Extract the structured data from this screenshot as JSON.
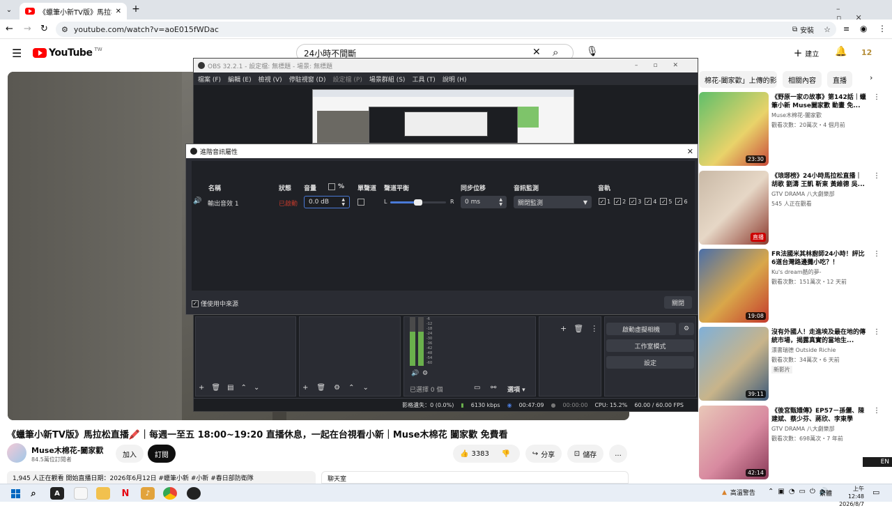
{
  "browser": {
    "tab_title": "《蠟筆小新TV版》馬拉松直",
    "url": "youtube.com/watch?v=aoE015fWDac",
    "install_label": "安裝"
  },
  "youtube": {
    "logo_text": "YouTube",
    "region": "TW",
    "search_value": "24小時不間斷",
    "create_label": "建立",
    "notif_count": "12",
    "video_title": "《蠟筆小新TV版》馬拉松直播🖍️｜每週一至五 18:00~19:20 直播休息，一起在台視看小新｜Muse木棉花 闔家歡 免費看",
    "channel_name": "Muse木棉花-闔家歡",
    "subscribers": "84.5萬位訂閱者",
    "join_label": "加入",
    "subscribe_label": "訂閱",
    "likes": "3383",
    "share_label": "分享",
    "save_label": "儲存",
    "more_label": "...",
    "watching_line": "1,945 人正在觀看  開始直播日期：2026年6月12日  #蠟筆小新 #小新 #春日部防衛隊",
    "chat_label": "聊天室",
    "chips": [
      "棉花-闔家歡」上傳的影片",
      "相關內容",
      "直播"
    ],
    "recommendations": [
      {
        "title": "《野原一家の故事》第142話｜蠟筆小新 Muse闔家歡 動畫 免...",
        "channel": "Muse木棉花-闔家歡",
        "meta": "觀看次數：20萬次・4 個月前",
        "duration": "23:30"
      },
      {
        "title": "《琅琊榜》24小時馬拉松直播｜胡歌 劉濤 王凱 靳東 黃維德 吳...",
        "channel": "GTV DRAMA 八大劇樂部",
        "meta": "545 人正在觀看",
        "duration": "直播"
      },
      {
        "title": "FR法國米其林廚師24小時！評比6道台灣路邊攤小吃？！",
        "channel": "Ku's dream酷的夢-",
        "meta": "觀看次數：151萬次・12 天前",
        "duration": "19:08"
      },
      {
        "title": "沒有外國人！走進埃及最在地的傳統市場，揭露真實的當地生...",
        "channel": "漂書瑞德 Outside Richie",
        "meta": "觀看次數：34萬次・6 天前",
        "extra": "新影片",
        "duration": "39:11"
      },
      {
        "title": "《後宮甄嬛傳》EP57－孫儷、陳建斌、蔡少芬、蔣欣、李東學",
        "channel": "GTV DRAMA 八大劇樂部",
        "meta": "觀看次數：698萬次・7 年前",
        "duration": "42:14"
      }
    ]
  },
  "obs": {
    "title": "OBS 32.2.1 - 設定檔: 無標題 - 場景: 無標題",
    "menu": [
      "檔案 (F)",
      "編輯 (E)",
      "檢視 (V)",
      "停駐視窗 (D)",
      "設定檔 (P)",
      "場景群組 (S)",
      "工具 (T)",
      "說明 (H)"
    ],
    "dialog_title": "進階音訊屬性",
    "headers": {
      "name": "名稱",
      "status": "狀態",
      "volume": "音量",
      "percent": "%",
      "mono": "單聲道",
      "balance": "聲道平衡",
      "sync": "同步位移",
      "monitor": "音訊監測",
      "tracks": "音軌"
    },
    "row": {
      "name": "輸出音效 1",
      "status": "已啟動",
      "volume": "0.0 dB",
      "balance_l": "L",
      "balance_r": "R",
      "sync": "0 ms",
      "monitor": "關閉監測"
    },
    "tracks": [
      "1",
      "2",
      "3",
      "4",
      "5",
      "6"
    ],
    "active_only_label": "僅使用中來源",
    "close_label": "關閉",
    "virtual_cam_label": "啟動虛擬相機",
    "studio_mode_label": "工作室模式",
    "settings_label": "設定",
    "selected_label": "已選擇 0 個",
    "options_label": "選項",
    "meter_ticks": [
      "-6",
      "-12",
      "-18",
      "-24",
      "-30",
      "-36",
      "-42",
      "-48",
      "-54",
      "-60"
    ],
    "status": {
      "dropped": "影格遺失：0 (0.0%)",
      "bitrate": "6130 kbps",
      "rec_time": "00:47:09",
      "stream_time": "00:00:00",
      "cpu": "CPU: 15.2%",
      "fps": "60.00 / 60.00 FPS"
    }
  },
  "taskbar": {
    "warning": "高溫警告",
    "ime": "繁體",
    "time": "上午 12:48",
    "date": "2026/8/7",
    "lang": "EN"
  }
}
